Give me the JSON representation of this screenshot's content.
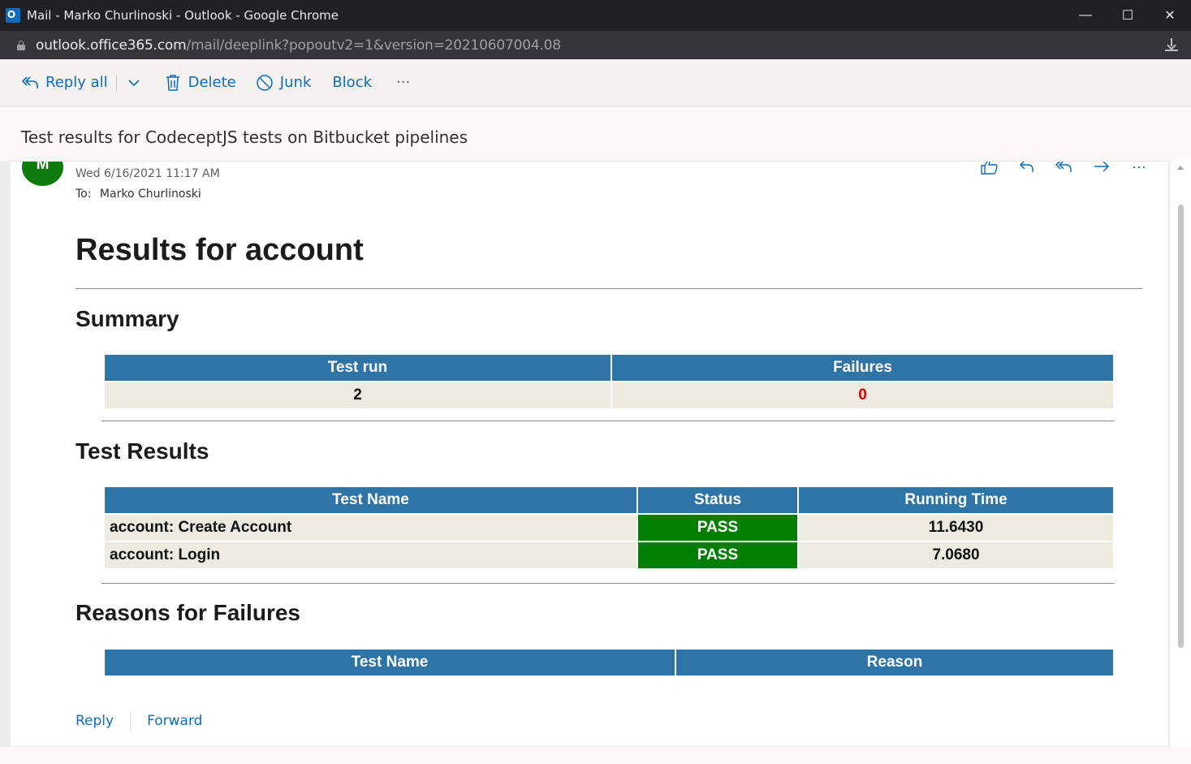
{
  "window": {
    "title": "Mail - Marko Churlinoski - Outlook - Google Chrome",
    "controls": {
      "minimize": "—",
      "maximize": "☐",
      "close": "✕"
    }
  },
  "urlbar": {
    "host": "outlook.office365.com",
    "path": "/mail/deeplink?popoutv2=1&version=20210607004.08"
  },
  "toolbar": {
    "reply_all": "Reply all",
    "delete": "Delete",
    "junk": "Junk",
    "block": "Block",
    "more": "···"
  },
  "message": {
    "subject": "Test results for CodeceptJS tests on Bitbucket pipelines",
    "avatar_initial": "M",
    "date": "Wed 6/16/2021 11:17 AM",
    "to_label": "To:",
    "to_name": "Marko Churlinoski",
    "actions_more": "···"
  },
  "body": {
    "title": "Results for account",
    "summary": {
      "heading": "Summary",
      "headers": [
        "Test run",
        "Failures"
      ],
      "row": [
        "2",
        "0"
      ]
    },
    "results": {
      "heading": "Test Results",
      "headers": [
        "Test Name",
        "Status",
        "Running Time"
      ],
      "rows": [
        [
          "account: Create Account",
          "PASS",
          "11.6430"
        ],
        [
          "account: Login",
          "PASS",
          "7.0680"
        ]
      ]
    },
    "failures": {
      "heading": "Reasons for Failures",
      "headers": [
        "Test Name",
        "Reason"
      ]
    }
  },
  "footer": {
    "reply": "Reply",
    "forward": "Forward"
  },
  "colors": {
    "accent": "#0f6cbd",
    "table_header": "#2e74a6",
    "table_cell": "#ecebe1",
    "pass": "#008000",
    "fail_text": "#e00000",
    "avatar": "#107c10"
  }
}
